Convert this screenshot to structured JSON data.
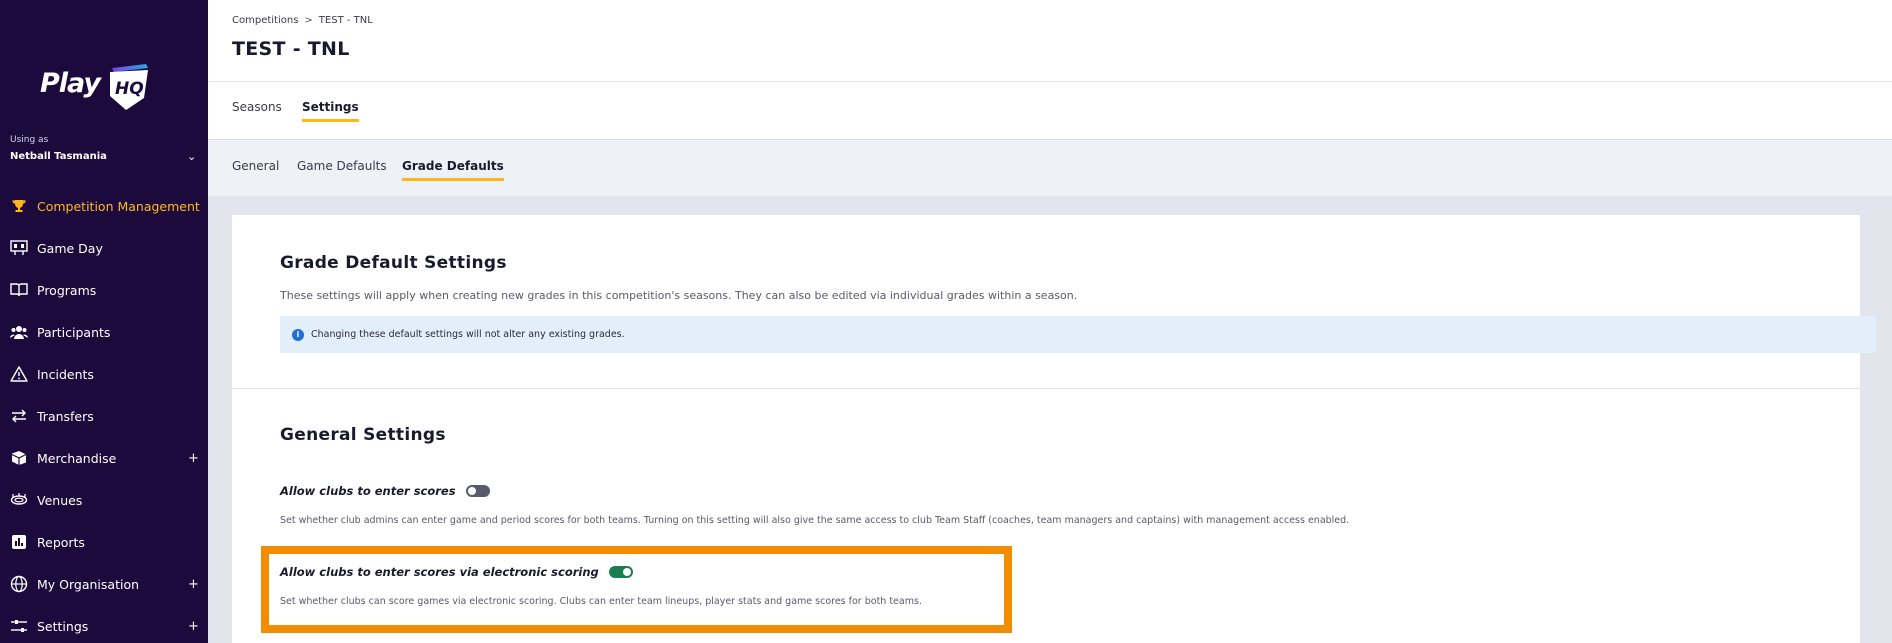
{
  "sidebar": {
    "logo_text": "Play",
    "logo_mark": "HQ",
    "using_as_label": "Using as",
    "organisation": "Netball Tasmania",
    "items": [
      {
        "label": "Competition Management",
        "icon": "trophy-icon",
        "active": true
      },
      {
        "label": "Game Day",
        "icon": "scoreboard-icon"
      },
      {
        "label": "Programs",
        "icon": "book-icon"
      },
      {
        "label": "Participants",
        "icon": "people-icon"
      },
      {
        "label": "Incidents",
        "icon": "warning-icon"
      },
      {
        "label": "Transfers",
        "icon": "transfer-arrows-icon"
      },
      {
        "label": "Merchandise",
        "icon": "box-icon",
        "expandable": true
      },
      {
        "label": "Venues",
        "icon": "stadium-icon"
      },
      {
        "label": "Reports",
        "icon": "report-icon"
      },
      {
        "label": "My Organisation",
        "icon": "globe-icon",
        "expandable": true
      },
      {
        "label": "Settings",
        "icon": "sliders-icon",
        "expandable": true
      }
    ],
    "expand_symbol": "+",
    "active_color": "#ffb81c",
    "background": "#1d0a3d"
  },
  "header": {
    "breadcrumb": [
      "Competitions",
      "TEST - TNL"
    ],
    "breadcrumb_separator": ">",
    "title": "TEST - TNL"
  },
  "tabs": [
    {
      "label": "Seasons",
      "active": false
    },
    {
      "label": "Settings",
      "active": true
    }
  ],
  "subtabs": [
    {
      "label": "General",
      "active": false
    },
    {
      "label": "Game Defaults",
      "active": false
    },
    {
      "label": "Grade Defaults",
      "active": true
    }
  ],
  "grade_defaults": {
    "title": "Grade Default Settings",
    "description": "These settings will apply when creating new grades in this competition's seasons. They can also be edited via individual grades within a season.",
    "info_icon": "i",
    "info_text": "Changing these default settings will not alter any existing grades."
  },
  "general_settings": {
    "title": "General Settings",
    "settings": [
      {
        "label": "Allow clubs to enter scores",
        "enabled": false,
        "description": "Set whether club admins can enter game and period scores for both teams. Turning on this setting will also give the same access to club Team Staff (coaches, team managers and captains) with management access enabled."
      },
      {
        "label": "Allow clubs to enter scores via electronic scoring",
        "enabled": true,
        "description": "Set whether clubs can score games via electronic scoring. Clubs can enter team lineups, player stats and game scores for both teams."
      }
    ]
  },
  "highlight_color": "#f28c00",
  "toggle_on_color": "#1a7f4f"
}
